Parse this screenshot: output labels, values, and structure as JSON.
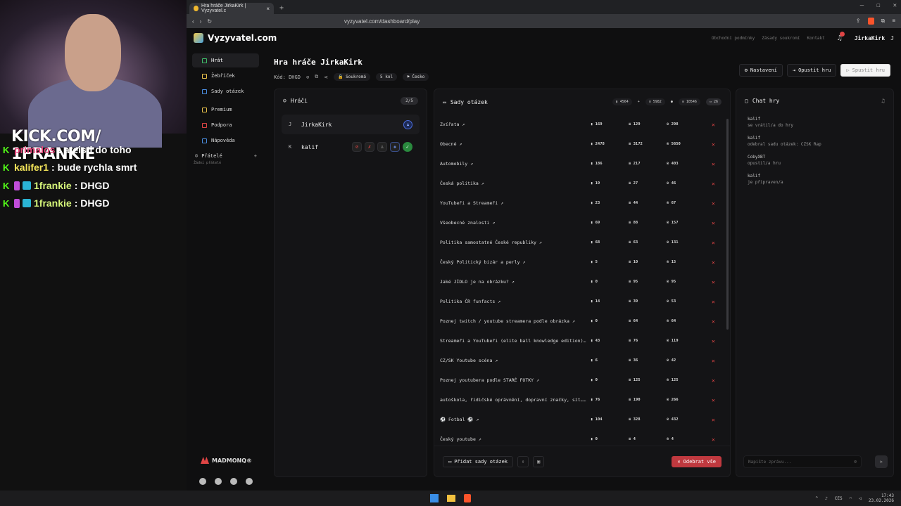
{
  "overlay": {
    "brand": "KICK.COM/ 1FRANKIE",
    "chat": [
      {
        "user": "primalos",
        "msg": " : ateisti do toho"
      },
      {
        "user": "kalifer1",
        "msg": " : bude rychla smrt"
      },
      {
        "user": "1frankie",
        "msg": " : DHGD"
      },
      {
        "user": "1frankie",
        "msg": " : DHGD"
      }
    ]
  },
  "browser": {
    "tab_title": "Hra hráče JirkaKirk | Vyzyvatel.c",
    "url": "vyzyvatel.com/dashboard/play"
  },
  "site": {
    "logo": "Vyzyvatel.com",
    "top_links": [
      "Obchodní podmínky",
      "Zásady soukromí",
      "Kontakt"
    ],
    "user": "JirkaKirk",
    "user_initial": "J"
  },
  "sidebar": {
    "items": [
      {
        "label": "Hrát"
      },
      {
        "label": "Žebříček"
      },
      {
        "label": "Sady otázek"
      },
      {
        "label": "Premium"
      },
      {
        "label": "Podpora"
      },
      {
        "label": "Nápověda"
      }
    ],
    "friends": "Přátelé",
    "friends_empty": "Žádní přátelé",
    "madmonq": "MADMONQ®"
  },
  "game": {
    "title": "Hra hráče JirkaKirk",
    "code": "Kód: DHGD",
    "private": "Soukromá",
    "rounds": "5 kol",
    "lang": "Česko",
    "settings_btn": "Nastavení",
    "leave_btn": "Opustit hru",
    "start_btn": "Spustit hru"
  },
  "players": {
    "title": "Hráči",
    "count": "2/5",
    "list": [
      {
        "initial": "J",
        "name": "JirkaKirk"
      },
      {
        "initial": "K",
        "name": "kalif"
      }
    ]
  },
  "sets": {
    "title": "Sady otázek",
    "stat1": "4564",
    "stat2": "5982",
    "stat3": "10546",
    "selected": "26",
    "rows": [
      {
        "name": "Zvířata",
        "a": "169",
        "b": "129",
        "c": "298"
      },
      {
        "name": "Obecné",
        "a": "2478",
        "b": "3172",
        "c": "5650"
      },
      {
        "name": "Automobily",
        "a": "186",
        "b": "217",
        "c": "403"
      },
      {
        "name": "Česká politika",
        "a": "19",
        "b": "27",
        "c": "46"
      },
      {
        "name": "YouTubeři a Streameři",
        "a": "23",
        "b": "44",
        "c": "67"
      },
      {
        "name": "Všeobecné znalosti",
        "a": "69",
        "b": "88",
        "c": "157"
      },
      {
        "name": "Politika samostatné České republiky",
        "a": "68",
        "b": "63",
        "c": "131"
      },
      {
        "name": "Český Politický bizár a perly",
        "a": "5",
        "b": "10",
        "c": "15"
      },
      {
        "name": "Jaké JÍDLO je na obrázku?",
        "a": "0",
        "b": "95",
        "c": "95"
      },
      {
        "name": "Politika ČR funfacts",
        "a": "14",
        "b": "39",
        "c": "53"
      },
      {
        "name": "Poznej twitch / youtube streamera podle obrázka",
        "a": "0",
        "b": "64",
        "c": "64"
      },
      {
        "name": "Streameři a YouTubeři (elite ball knowledge edition)",
        "a": "43",
        "b": "76",
        "c": "119"
      },
      {
        "name": "CZ/SK Youtube scéna",
        "a": "6",
        "b": "36",
        "c": "42"
      },
      {
        "name": "Poznej youtubera podle STARÉ FOTKY",
        "a": "0",
        "b": "125",
        "c": "125"
      },
      {
        "name": "autoškola, řidičské oprávnění, dopravní značky, sít…",
        "a": "76",
        "b": "190",
        "c": "266"
      },
      {
        "name": "⚽ Fotbal ⚽",
        "a": "104",
        "b": "328",
        "c": "432"
      },
      {
        "name": "Český youtube",
        "a": "0",
        "b": "4",
        "c": "4"
      }
    ],
    "add_btn": "Přidat sady otázek",
    "remove_btn": "Odebrat vše"
  },
  "chat": {
    "title": "Chat hry",
    "messages": [
      {
        "who": "kalif",
        "what": "se vrátil/a do hry"
      },
      {
        "who": "kalif",
        "what": "odebral sadu otázek: CZSK Rap"
      },
      {
        "who": "CobyXBT",
        "what": "opustil/a hru"
      },
      {
        "who": "kalif",
        "what": "je připraven/a"
      }
    ],
    "placeholder": "Napište zprávu..."
  },
  "taskbar": {
    "lang": "CES",
    "time": "17:43",
    "date": "23.02.2026"
  }
}
